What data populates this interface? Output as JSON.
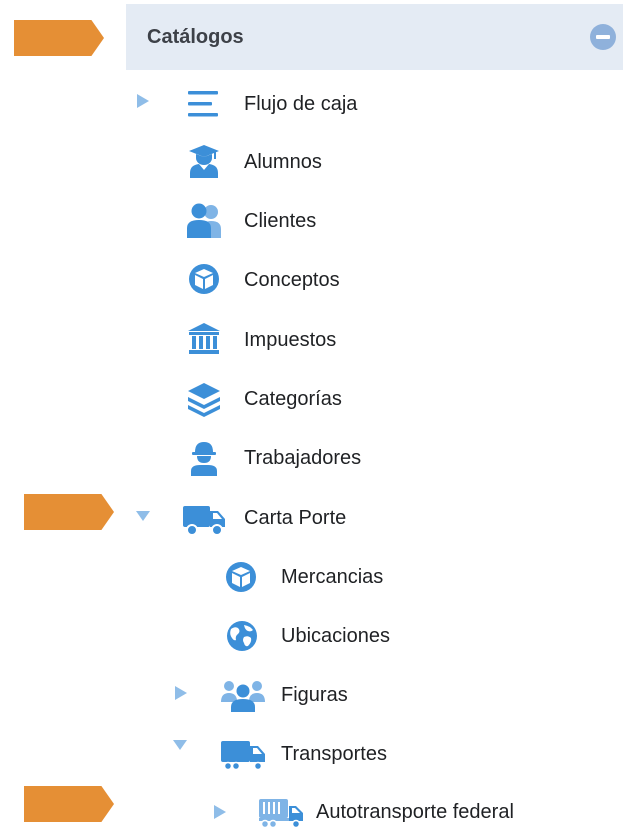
{
  "header": {
    "title": "Catálogos"
  },
  "items": {
    "flujo": "Flujo de caja",
    "alumnos": "Alumnos",
    "clientes": "Clientes",
    "conceptos": "Conceptos",
    "impuestos": "Impuestos",
    "categorias": "Categorías",
    "trabajadores": "Trabajadores",
    "carta_porte": "Carta Porte",
    "mercancias": "Mercancias",
    "ubicaciones": "Ubicaciones",
    "figuras": "Figuras",
    "transportes": "Transportes",
    "autotransporte": "Autotransporte federal"
  },
  "colors": {
    "icon_blue": "#3c8fd8",
    "header_bg": "#e4ebf4",
    "arrow_orange": "#e58f35",
    "tree_triangle": "#8fbde8"
  },
  "icons": {
    "flujo": "lines-icon",
    "alumnos": "graduate-icon",
    "clientes": "users-icon",
    "conceptos": "box-icon",
    "impuestos": "bank-icon",
    "categorias": "layers-icon",
    "trabajadores": "worker-icon",
    "carta_porte": "truck-icon",
    "mercancias": "box-icon",
    "ubicaciones": "globe-icon",
    "figuras": "people-group-icon",
    "transportes": "truck-icon",
    "autotransporte": "trailer-truck-icon"
  }
}
